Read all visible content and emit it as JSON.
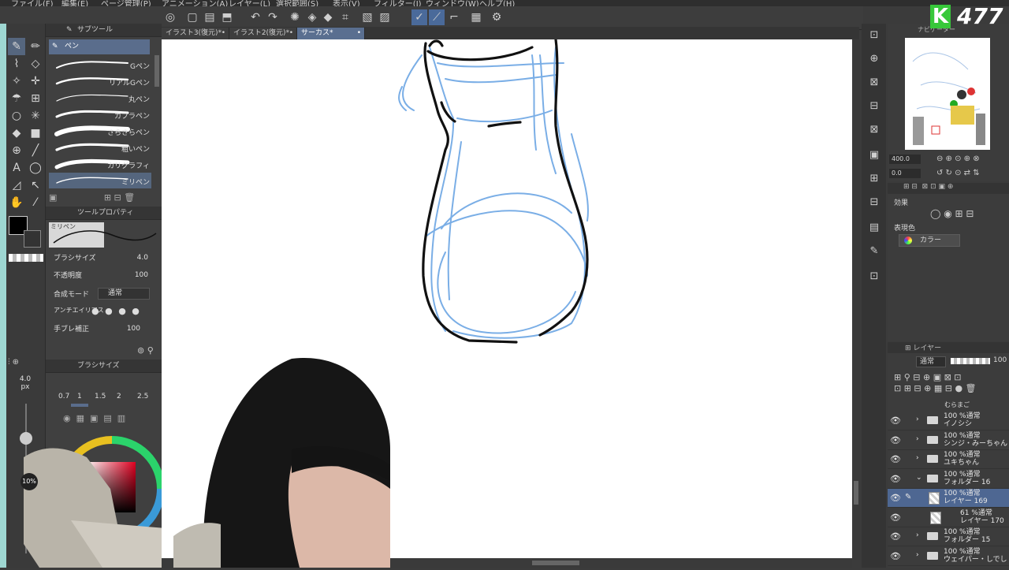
{
  "menu": [
    "ファイル(F)",
    "編集(E)",
    "ページ管理(P)",
    "アニメーション(A)",
    "レイヤー(L)",
    "選択範囲(S)",
    "表示(V)",
    "フィルター(I)",
    "ウィンドウ(W)",
    "ヘルプ(H)"
  ],
  "tabs": [
    {
      "label": "イラスト3(復元)*",
      "active": false
    },
    {
      "label": "イラスト2(復元)*",
      "active": false
    },
    {
      "label": "サーカス*",
      "active": true
    }
  ],
  "subtool": {
    "title": "サブツール",
    "group": "ペン",
    "brushes": [
      "Gペン",
      "リアルGペン",
      "丸ペン",
      "カブラペン",
      "さらさらペン",
      "粗いペン",
      "カリグラフィ",
      "ミリペン"
    ]
  },
  "toolprop": {
    "title": "ツールプロパティ",
    "preview_name": "ミリペン",
    "brush_size_label": "ブラシサイズ",
    "brush_size_value": "4.0",
    "opacity_label": "不透明度",
    "opacity_value": "100",
    "blend_label": "合成モード",
    "blend_value": "通常",
    "antialias_label": "アンチエイリアス",
    "stabilize_label": "手ブレ補正",
    "stabilize_value": "100"
  },
  "brushsize": {
    "title": "ブラシサイズ",
    "current": "4.0",
    "unit": "px",
    "presets": [
      "0.7",
      "1",
      "1.5",
      "2",
      "2.5"
    ],
    "color_percent": "10%"
  },
  "navigator": {
    "title": "ナビゲーター",
    "zoom": "400.0",
    "angle": "0.0"
  },
  "effects": {
    "title": "効果",
    "express_label": "表現色",
    "express_value": "カラー"
  },
  "layers": {
    "title": "レイヤー",
    "blend": "通常",
    "opacity": "100",
    "top_partial": "むらまご",
    "rows": [
      {
        "t1": "100 %通常",
        "t2": "イノシシ",
        "type": "folder",
        "selected": false
      },
      {
        "t1": "100 %通常",
        "t2": "シンジ・みーちゃん",
        "type": "folder",
        "selected": false
      },
      {
        "t1": "100 %通常",
        "t2": "ユキちゃん",
        "type": "folder",
        "selected": false
      },
      {
        "t1": "100 %通常",
        "t2": "フォルダー 16",
        "type": "folder-open",
        "selected": false
      },
      {
        "t1": "100 %通常",
        "t2": "レイヤー 169",
        "type": "layer",
        "selected": true
      },
      {
        "t1": "61 %通常",
        "t2": "レイヤー 170",
        "type": "layer",
        "selected": false
      },
      {
        "t1": "100 %通常",
        "t2": "フォルダー 15",
        "type": "folder",
        "selected": false
      },
      {
        "t1": "100 %通常",
        "t2": "ウェイパー・しでし",
        "type": "folder",
        "selected": false
      }
    ]
  },
  "overlay": {
    "logo_letter": "K",
    "logo_number": "477"
  },
  "colors": {
    "accent": "#55667e",
    "sketch_blue": "#7aaee6",
    "line": "#111111",
    "logo_green": "#37c83a"
  }
}
